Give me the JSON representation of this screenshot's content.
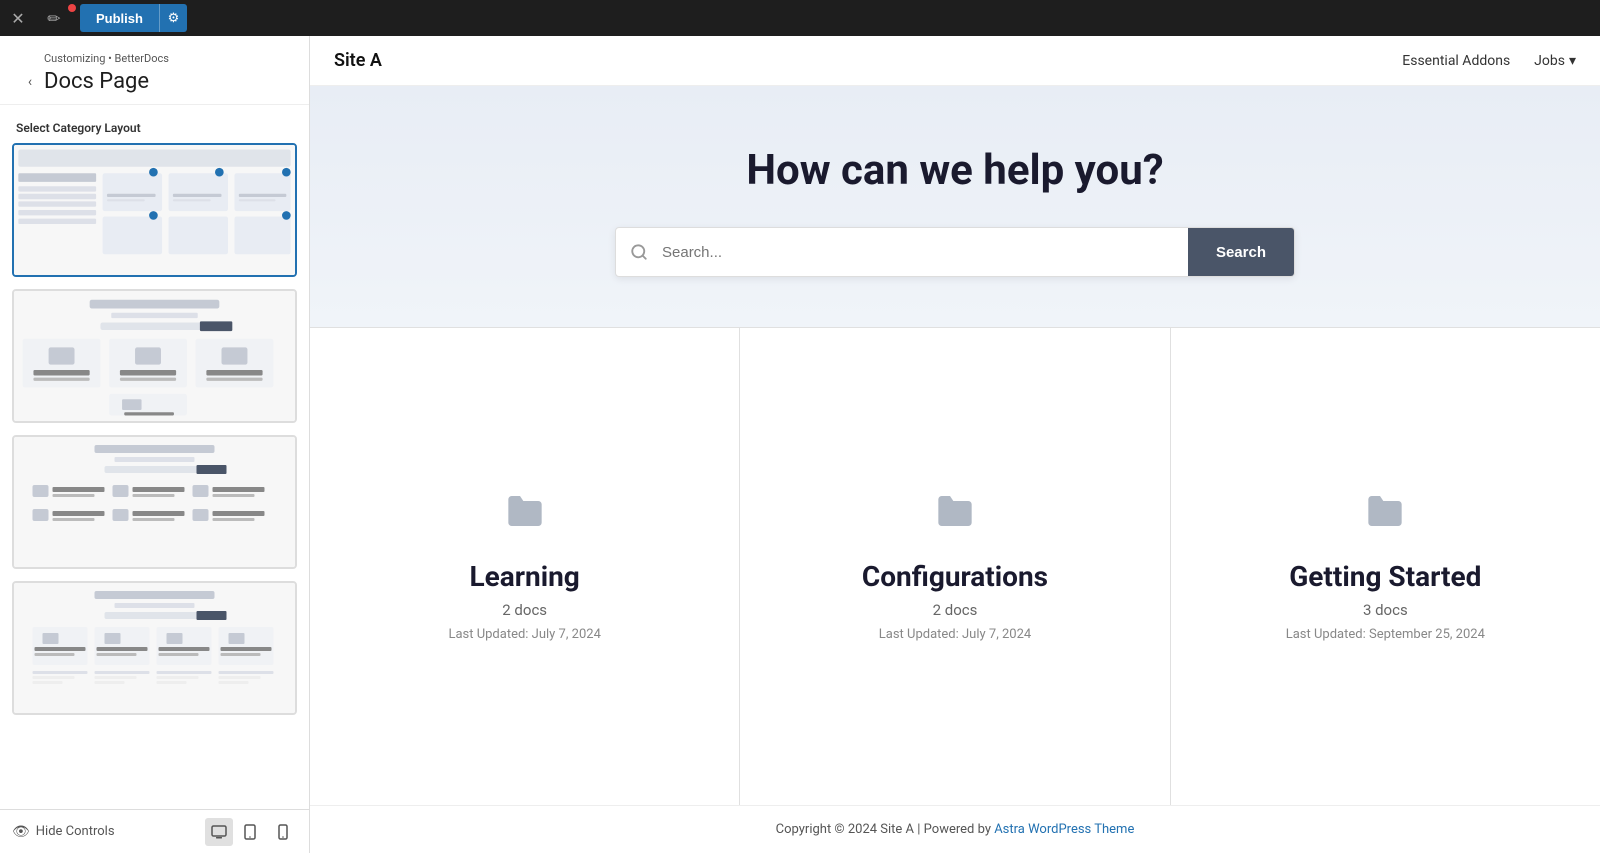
{
  "topbar": {
    "close_icon": "✕",
    "edit_icon": "✏",
    "publish_label": "Publish",
    "gear_icon": "⚙"
  },
  "sidebar": {
    "breadcrumb": "Customizing • BetterDocs",
    "title": "Docs Page",
    "section_label": "Select Category Layout",
    "back_icon": "‹",
    "layouts": [
      {
        "id": "layout-1",
        "selected": true
      },
      {
        "id": "layout-2",
        "selected": false
      },
      {
        "id": "layout-3",
        "selected": false
      },
      {
        "id": "layout-4",
        "selected": false
      }
    ]
  },
  "bottom_bar": {
    "hide_controls_label": "Hide Controls",
    "eye_icon": "👁",
    "desktop_icon": "🖥",
    "tablet_icon": "▭",
    "mobile_icon": "📱"
  },
  "main": {
    "site_title": "Site A",
    "nav_essential_addons": "Essential Addons",
    "nav_jobs": "Jobs",
    "nav_jobs_arrow": "▾",
    "hero_title": "How can we help you?",
    "search_placeholder": "Search...",
    "search_button_label": "Search",
    "categories": [
      {
        "name": "Learning",
        "docs_count": "2 docs",
        "last_updated": "Last Updated: July 7, 2024"
      },
      {
        "name": "Configurations",
        "docs_count": "2 docs",
        "last_updated": "Last Updated: July 7, 2024"
      },
      {
        "name": "Getting Started",
        "docs_count": "3 docs",
        "last_updated": "Last Updated: September 25, 2024"
      }
    ],
    "footer_text": "Copyright © 2024 Site A | Powered by ",
    "footer_link_label": "Astra WordPress Theme",
    "footer_link_after": ""
  },
  "colors": {
    "publish_blue": "#2271b1",
    "search_btn_dark": "#4a5568",
    "hero_bg_start": "#e8edf5",
    "hero_bg_end": "#f0f4f9"
  }
}
